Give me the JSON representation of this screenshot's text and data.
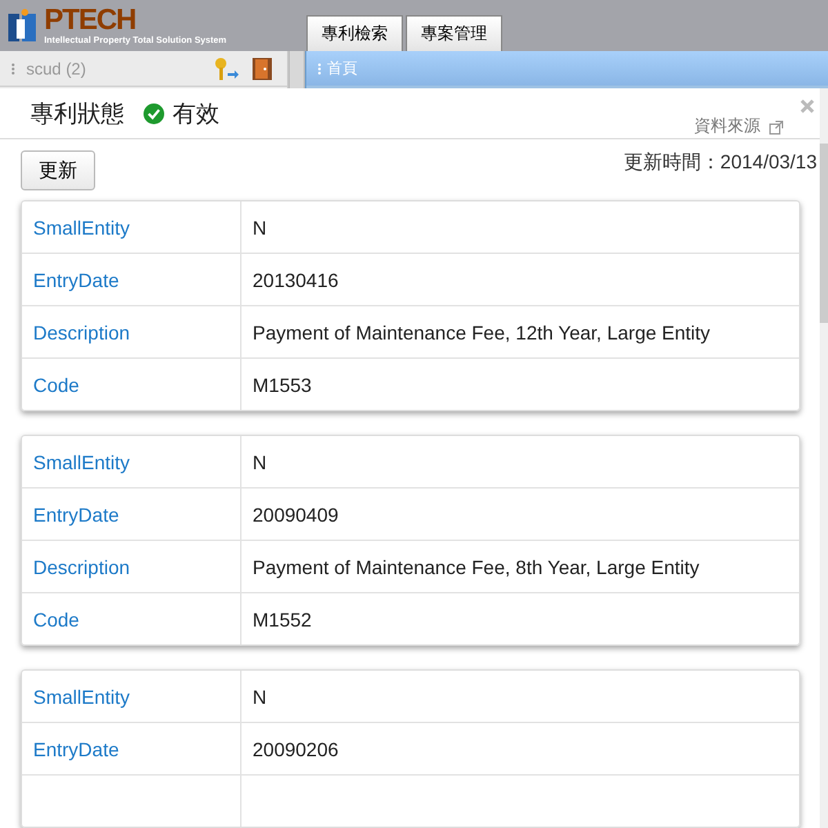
{
  "header": {
    "logo_text": "PTECH",
    "logo_tagline": "Intellectual Property Total Solution System",
    "tabs": [
      {
        "label": "專利檢索"
      },
      {
        "label": "專案管理"
      }
    ]
  },
  "user_panel": {
    "user": "scud",
    "count": "(2)"
  },
  "breadcrumb": {
    "label": "首頁"
  },
  "dialog": {
    "title": "專利狀態",
    "status": "有效",
    "status_valid": true,
    "source_link": "資料來源",
    "refresh_button": "更新",
    "updated": "更新時間：2014/03/13",
    "records": [
      {
        "rows": [
          {
            "label": "SmallEntity",
            "value": "N"
          },
          {
            "label": "EntryDate",
            "value": "20130416"
          },
          {
            "label": "Description",
            "value": "Payment of Maintenance Fee, 12th Year, Large Entity"
          },
          {
            "label": "Code",
            "value": "M1553"
          }
        ]
      },
      {
        "rows": [
          {
            "label": "SmallEntity",
            "value": "N"
          },
          {
            "label": "EntryDate",
            "value": "20090409"
          },
          {
            "label": "Description",
            "value": "Payment of Maintenance Fee, 8th Year, Large Entity"
          },
          {
            "label": "Code",
            "value": "M1552"
          }
        ]
      },
      {
        "rows": [
          {
            "label": "SmallEntity",
            "value": "N"
          },
          {
            "label": "EntryDate",
            "value": "20090206"
          }
        ]
      }
    ]
  }
}
